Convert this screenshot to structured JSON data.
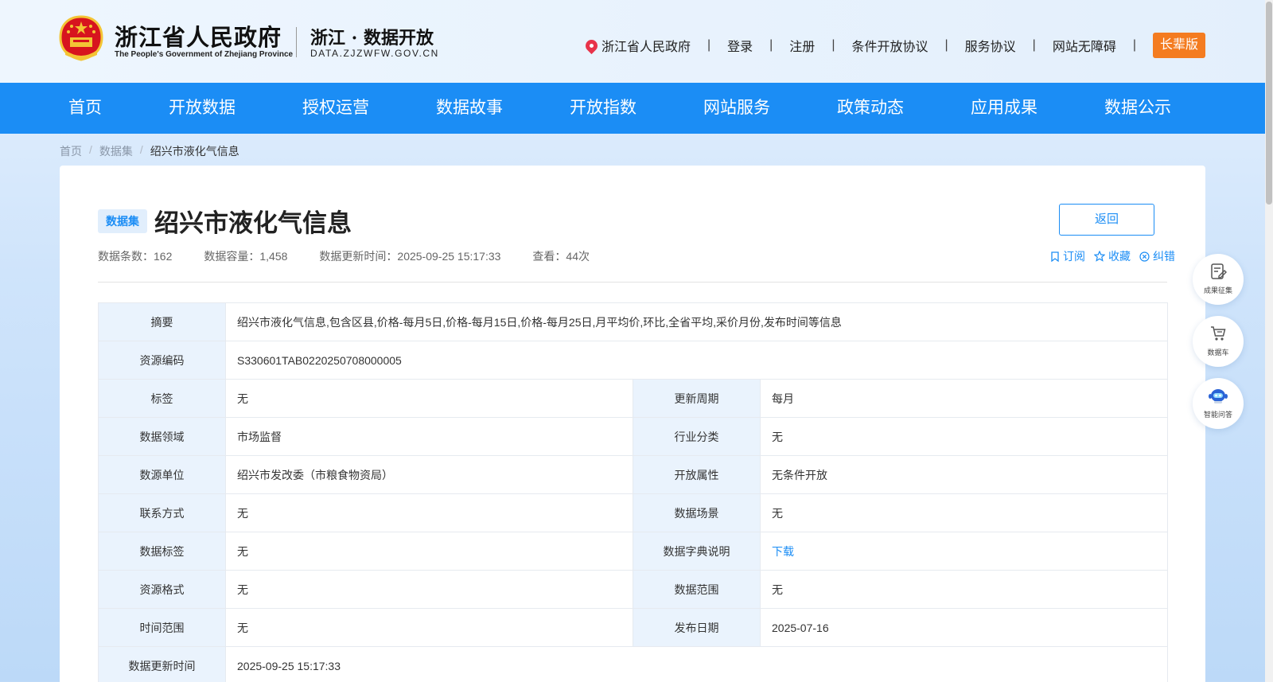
{
  "header": {
    "brand_cn": "浙江省人民政府",
    "brand_en": "The People's Government of Zhejiang Province",
    "portal_cn": "浙江 · 数据开放",
    "portal_url": "DATA.ZJZWFW.GOV.CN",
    "links": [
      "浙江省人民政府",
      "登录",
      "注册",
      "条件开放协议",
      "服务协议",
      "网站无障碍"
    ],
    "separator": "|",
    "elder_mode": "长辈版"
  },
  "nav": [
    "首页",
    "开放数据",
    "授权运营",
    "数据故事",
    "开放指数",
    "网站服务",
    "政策动态",
    "应用成果",
    "数据公示"
  ],
  "breadcrumb": {
    "items": [
      "首页",
      "数据集",
      "绍兴市液化气信息"
    ],
    "separator": "/"
  },
  "dataset": {
    "badge": "数据集",
    "title": "绍兴市液化气信息",
    "back": "返回",
    "meta": {
      "records": "数据条数：162",
      "capacity": "数据容量：1,458",
      "updated": "数据更新时间：2025-09-25 15:17:33",
      "views": "查看：44次"
    },
    "actions": {
      "subscribe": "订阅",
      "favorite": "收藏",
      "report": "纠错"
    },
    "rows": {
      "summary": {
        "label": "摘要",
        "value": "绍兴市液化气信息,包含区县,价格-每月5日,价格-每月15日,价格-每月25日,月平均价,环比,全省平均,采价月份,发布时间等信息"
      },
      "code": {
        "label": "资源编码",
        "value": "S330601TAB0220250708000005"
      },
      "tags": {
        "label": "标签",
        "value": "无"
      },
      "cycle": {
        "label": "更新周期",
        "value": "每月"
      },
      "domain": {
        "label": "数据领域",
        "value": "市场监督"
      },
      "industry": {
        "label": "行业分类",
        "value": "无"
      },
      "source": {
        "label": "数源单位",
        "value": "绍兴市发改委（市粮食物资局）"
      },
      "open_attr": {
        "label": "开放属性",
        "value": "无条件开放"
      },
      "contact": {
        "label": "联系方式",
        "value": "无"
      },
      "scene": {
        "label": "数据场景",
        "value": "无"
      },
      "data_tags": {
        "label": "数据标签",
        "value": "无"
      },
      "dictionary": {
        "label": "数据字典说明",
        "value": "下载"
      },
      "format": {
        "label": "资源格式",
        "value": "无"
      },
      "scope": {
        "label": "数据范围",
        "value": "无"
      },
      "time_range": {
        "label": "时间范围",
        "value": "无"
      },
      "publish_date": {
        "label": "发布日期",
        "value": "2025-07-16"
      },
      "update_time": {
        "label": "数据更新时间",
        "value": "2025-09-25 15:17:33"
      }
    }
  },
  "floating": [
    "成果征集",
    "数据车",
    "智能问答"
  ],
  "colors": {
    "nav_blue": "#1b8df5",
    "elder_orange": "#f47c20",
    "label_bg": "#eaf3fd",
    "emblem_red": "#d7141e",
    "emblem_gold": "#f3c535"
  }
}
